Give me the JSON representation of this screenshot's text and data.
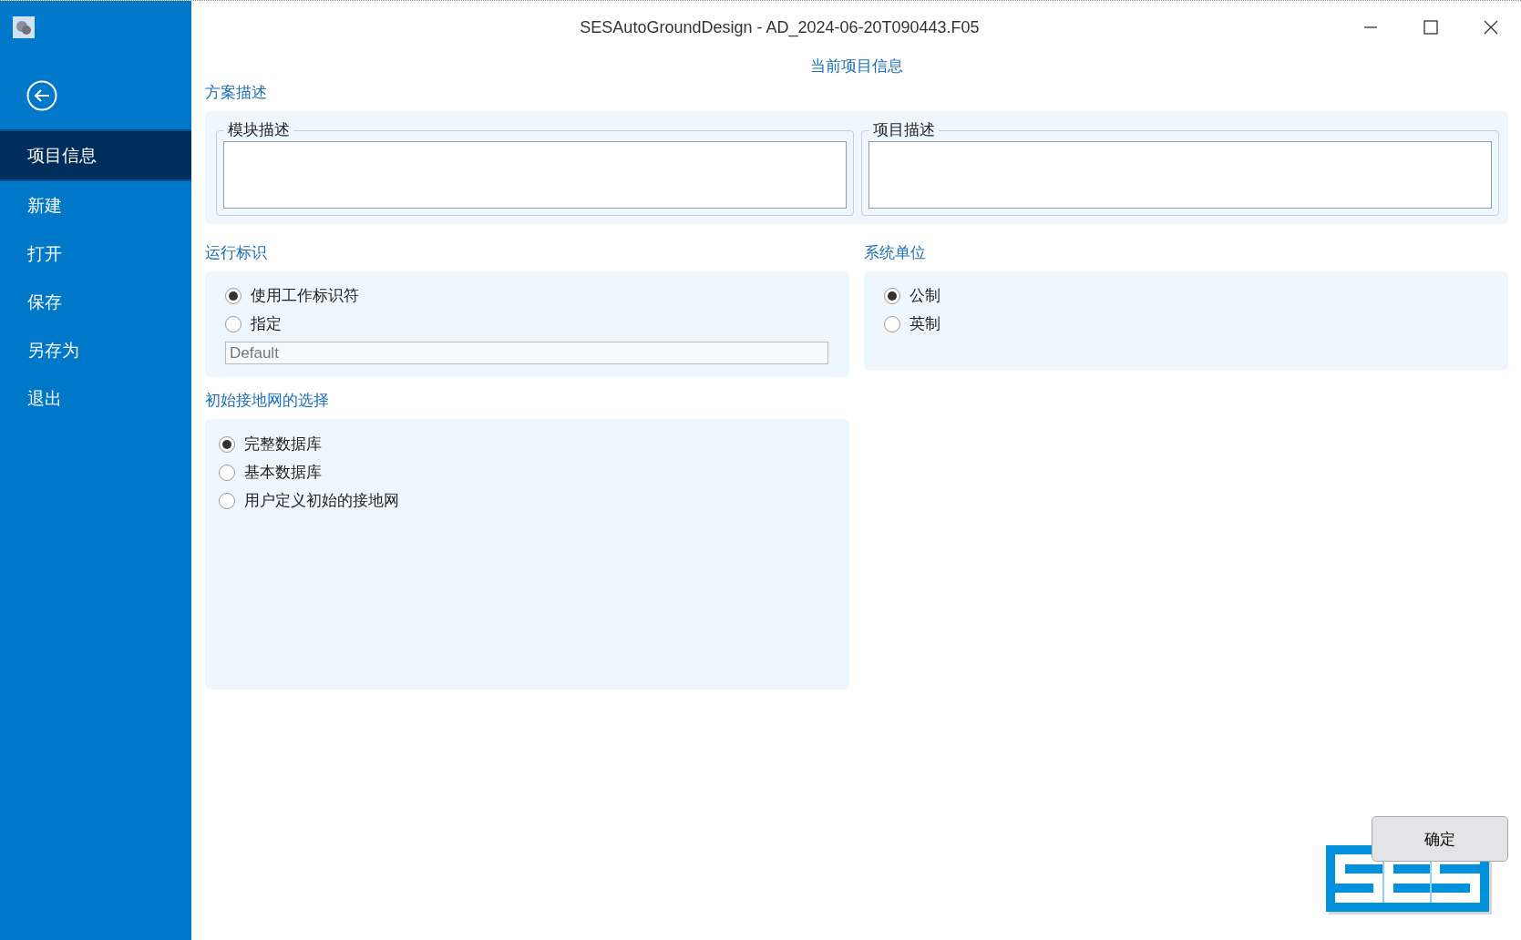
{
  "window": {
    "title": "SESAutoGroundDesign - AD_2024-06-20T090443.F05"
  },
  "sidebar": {
    "items": [
      {
        "label": "项目信息",
        "selected": true
      },
      {
        "label": "新建",
        "selected": false
      },
      {
        "label": "打开",
        "selected": false
      },
      {
        "label": "保存",
        "selected": false
      },
      {
        "label": "另存为",
        "selected": false
      },
      {
        "label": "退出",
        "selected": false
      }
    ]
  },
  "page_title": "当前项目信息",
  "scheme": {
    "heading": "方案描述",
    "groups": [
      {
        "label": "模块描述"
      },
      {
        "label": "项目描述"
      }
    ]
  },
  "run_id": {
    "heading": "运行标识",
    "options": [
      {
        "label": "使用工作标识符",
        "selected": true
      },
      {
        "label": "指定",
        "selected": false
      }
    ],
    "field": {
      "value": "Default",
      "disabled": true
    }
  },
  "units": {
    "heading": "系统单位",
    "options": [
      {
        "label": "公制",
        "selected": true
      },
      {
        "label": "英制",
        "selected": false
      }
    ]
  },
  "initial_grid": {
    "heading": "初始接地网的选择",
    "options": [
      {
        "label": "完整数据库",
        "selected": true
      },
      {
        "label": "基本数据库",
        "selected": false
      },
      {
        "label": "用户定义初始的接地网",
        "selected": false
      }
    ]
  },
  "buttons": [
    "确定"
  ]
}
